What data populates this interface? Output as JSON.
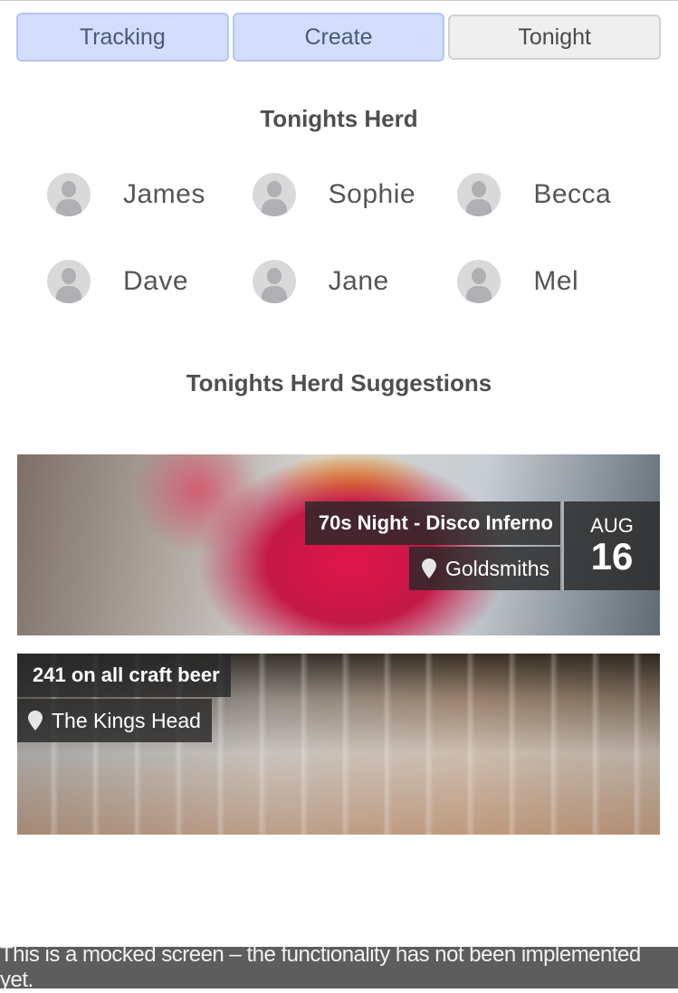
{
  "tabs": [
    {
      "label": "Tracking",
      "active": true
    },
    {
      "label": "Create",
      "active": true
    },
    {
      "label": "Tonight",
      "active": false
    }
  ],
  "herd": {
    "title": "Tonights Herd",
    "members": [
      "James",
      "Sophie",
      "Becca",
      "Dave",
      "Jane",
      "Mel"
    ]
  },
  "suggestions": {
    "title": "Tonights Herd Suggestions",
    "events": [
      {
        "title": "70s Night - Disco Inferno",
        "venue": "Goldsmiths",
        "month": "AUG",
        "day": "16"
      },
      {
        "title": "241 on all craft beer",
        "venue": "The Kings Head"
      }
    ]
  },
  "banner": "This is a mocked screen – the functionality has not been implemented yet.",
  "colors": {
    "tab_active_bg": "#d3defd",
    "tab_inactive_bg": "#efefef",
    "overlay": "#282828",
    "banner_bg": "#5d5d5d"
  },
  "icons": {
    "avatar": "person-placeholder-icon",
    "venue": "map-pin-icon"
  }
}
